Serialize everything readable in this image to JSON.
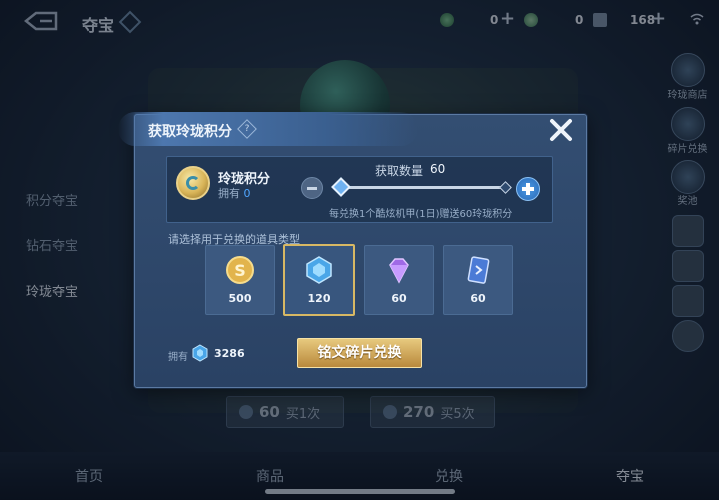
{
  "topbar": {
    "title": "夺宝",
    "res1_value": "0",
    "res2_value": "0",
    "res3_value": "168",
    "plus1": "+",
    "plus3": "+"
  },
  "sidebar": {
    "items": [
      {
        "label": "积分夺宝"
      },
      {
        "label": "钻石夺宝"
      },
      {
        "label": "玲珑夺宝"
      }
    ]
  },
  "right_rail": {
    "shop_label": "玲珑商店",
    "shard_label": "碎片兑换",
    "prize_label": "奖池"
  },
  "buy_buttons": [
    {
      "price": "60",
      "label": "买1次"
    },
    {
      "price": "270",
      "label": "买5次"
    }
  ],
  "bottom_nav": [
    {
      "label": "首页"
    },
    {
      "label": "商品"
    },
    {
      "label": "兑换"
    },
    {
      "label": "夺宝"
    }
  ],
  "dialog": {
    "title": "获取玲珑积分",
    "help_glyph": "?",
    "points": {
      "name": "玲珑积分",
      "own_label": "拥有",
      "own_value": "0"
    },
    "quantity": {
      "label": "获取数量",
      "value": "60",
      "slider_fraction": 0.0
    },
    "rate_note": "每兑换1个酷炫机甲(1日)赠送60玲珑积分",
    "choose_label": "请选择用于兑换的道具类型",
    "items": [
      {
        "value": "500",
        "icon": "gold-coin-icon"
      },
      {
        "value": "120",
        "icon": "blue-crystal-icon",
        "selected": true
      },
      {
        "value": "60",
        "icon": "purple-diamond-icon"
      },
      {
        "value": "60",
        "icon": "card-icon"
      }
    ],
    "own": {
      "label": "拥有",
      "value": "3286"
    },
    "exchange_button": "铭文碎片兑换"
  },
  "colors": {
    "accent_gold": "#d8b864",
    "accent_blue": "#4fa6ff",
    "panel": "#2a4264"
  }
}
